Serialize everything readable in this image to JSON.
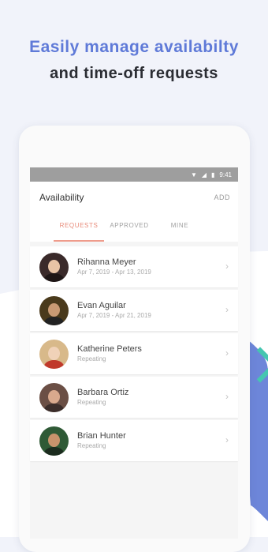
{
  "headline": {
    "line1": "Easily manage availabilty",
    "line2": "and time-off requests"
  },
  "status_bar": {
    "time": "9:41"
  },
  "app_bar": {
    "title": "Availability",
    "action": "ADD"
  },
  "tabs": [
    {
      "label": "REQUESTS",
      "active": true
    },
    {
      "label": "APPROVED",
      "active": false
    },
    {
      "label": "MINE",
      "active": false
    }
  ],
  "requests": [
    {
      "name": "Rihanna Meyer",
      "detail": "Apr 7, 2019 - Apr 13, 2019",
      "avatar_bg": "#3a2a2a"
    },
    {
      "name": "Evan Aguilar",
      "detail": "Apr 7, 2019 - Apr 21, 2019",
      "avatar_bg": "#4a3a1c"
    },
    {
      "name": "Katherine Peters",
      "detail": "Repeating",
      "avatar_bg": "#d8b98a"
    },
    {
      "name": "Barbara Ortiz",
      "detail": "Repeating",
      "avatar_bg": "#6b4f45"
    },
    {
      "name": "Brian Hunter",
      "detail": "Repeating",
      "avatar_bg": "#2f5a36"
    }
  ],
  "colors": {
    "accent_blue": "#5f7ad8",
    "accent_coral": "#e88b7a",
    "accent_teal": "#45c6b0"
  }
}
